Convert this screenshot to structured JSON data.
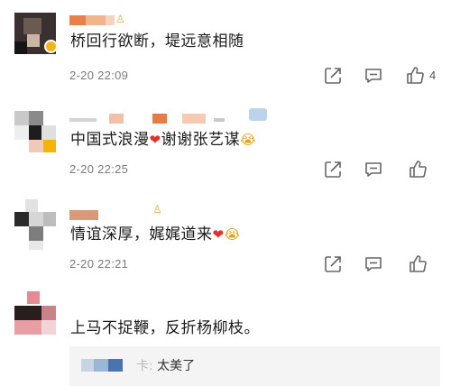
{
  "comments": [
    {
      "text": "桥回行欲断，堤远意相随",
      "time": "2-20 22:09",
      "like_count": "4"
    },
    {
      "text": "中国式浪漫",
      "text_after": "谢谢张艺谋",
      "time": "2-20 22:25"
    },
    {
      "text": "情谊深厚，娓娓道来",
      "time": "2-20 22:21"
    },
    {
      "text": "上马不捉鞭，反折杨柳枝。",
      "reply": {
        "suffix": "卡:",
        "text": "太美了"
      }
    }
  ],
  "icons": {
    "share": "share-icon",
    "comment": "comment-icon",
    "like": "like-icon",
    "heart": "heart-emoji-icon",
    "cry": "crying-emoji-icon"
  },
  "colors": {
    "text": "#1a1a1a",
    "time": "#7a7a7a",
    "icon": "#666666",
    "heart": "#e0312a",
    "reply_bg": "#f4f4f4"
  }
}
